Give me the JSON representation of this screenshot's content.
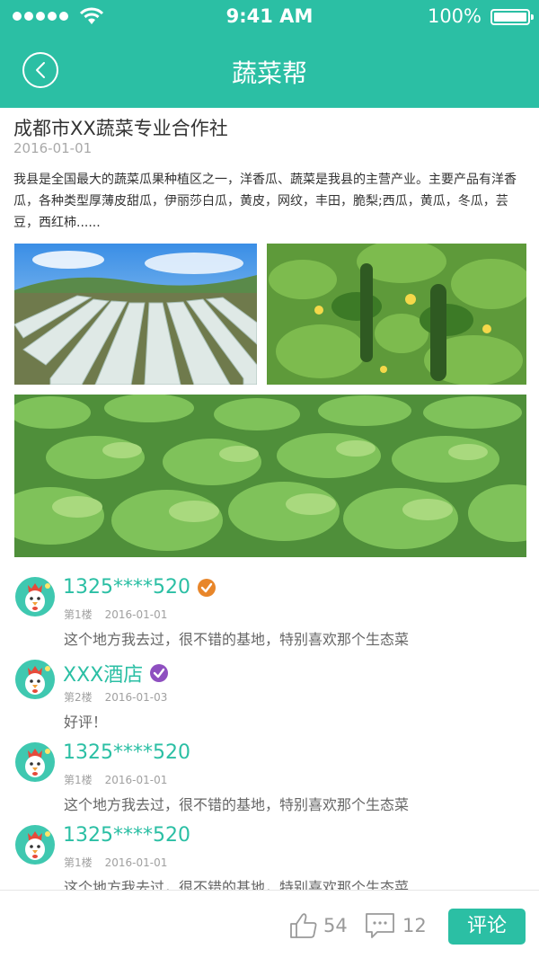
{
  "status_bar": {
    "time": "9:41 AM",
    "battery": "100%",
    "icons": [
      "signal-icon",
      "wifi-icon",
      "battery-icon"
    ]
  },
  "nav": {
    "title": "蔬菜帮",
    "back_icon": "back-arrow-icon"
  },
  "colors": {
    "accent": "#2bbfa4",
    "badge_orange": "#e8862a",
    "badge_purple": "#8e4fc0",
    "text_muted": "#a0a0a0"
  },
  "article": {
    "title": "成都市XX蔬菜专业合作社",
    "date": "2016-01-01",
    "body": "我县是全国最大的蔬菜瓜果种植区之一，洋香瓜、蔬菜是我县的主营产业。主要产品有洋香瓜，各种类型厚薄皮甜瓜，伊丽莎白瓜，黄皮，网纹，丰田，脆梨;西瓜，黄瓜，冬瓜，芸豆，西红柿......",
    "photos": [
      "greenhouse-photo",
      "cucumber-photo",
      "lettuce-field-photo"
    ]
  },
  "comments": [
    {
      "name": "1325****520",
      "badge": "check-orange",
      "floor": "第1楼",
      "date": "2016-01-01",
      "text": "这个地方我去过，很不错的基地，特别喜欢那个生态菜"
    },
    {
      "name": "XXX酒店",
      "badge": "check-purple",
      "floor": "第2楼",
      "date": "2016-01-03",
      "text": "好评！"
    },
    {
      "name": "1325****520",
      "badge": "",
      "floor": "第1楼",
      "date": "2016-01-01",
      "text": "这个地方我去过，很不错的基地，特别喜欢那个生态菜"
    },
    {
      "name": "1325****520",
      "badge": "",
      "floor": "第1楼",
      "date": "2016-01-01",
      "text": "这个地方我去过，很不错的基地，特别喜欢那个生态菜"
    }
  ],
  "bottom": {
    "likes": "54",
    "comments": "12",
    "comment_button": "评论"
  }
}
